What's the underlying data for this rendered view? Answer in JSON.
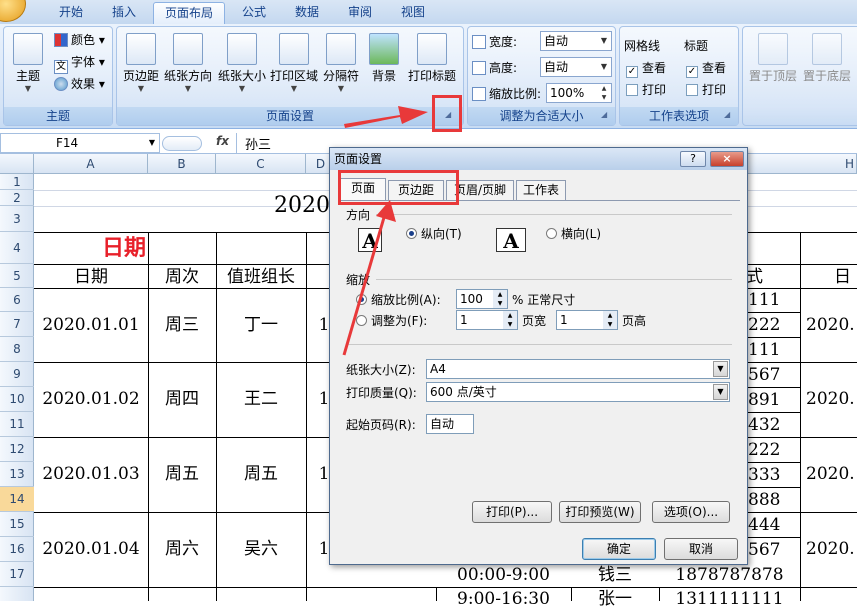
{
  "ribbon_tabs": [
    "开始",
    "插入",
    "页面布局",
    "公式",
    "数据",
    "审阅",
    "视图"
  ],
  "active_tab": "页面布局",
  "groups": {
    "theme": {
      "label": "主题",
      "big_button": "主题",
      "colors": "颜色",
      "fonts": "字体",
      "effects": "效果"
    },
    "page_setup": {
      "label": "页面设置",
      "buttons": [
        "页边距",
        "纸张方向",
        "纸张大小",
        "打印区域",
        "分隔符",
        "背景",
        "打印标题"
      ]
    },
    "scale": {
      "label": "调整为合适大小",
      "width_label": "宽度:",
      "width_value": "自动",
      "height_label": "高度:",
      "height_value": "自动",
      "scale_label": "缩放比例:",
      "scale_value": "100%"
    },
    "sheet_options": {
      "label": "工作表选项",
      "gridlines": "网格线",
      "headings": "标题",
      "view": "查看",
      "print": "打印"
    },
    "arrange": {
      "bring_front": "置于顶层",
      "send_back": "置于底层"
    }
  },
  "formula_bar": {
    "name_box": "F14",
    "fx": "fx",
    "value": "孙三"
  },
  "columns": [
    "A",
    "B",
    "C",
    "D"
  ],
  "right_col": "H",
  "rows": [
    "1",
    "2",
    "3",
    "4",
    "5",
    "6",
    "7",
    "8",
    "9",
    "10",
    "11",
    "12",
    "13",
    "14",
    "15",
    "16",
    "17"
  ],
  "sheet": {
    "title_partial": "2020",
    "red_heading": "日期",
    "header_row": [
      "日期",
      "周次",
      "值班组长"
    ],
    "right_header_partial": "式",
    "right_header_2": "日",
    "blocks": [
      {
        "date": "2020.01.01",
        "week": "周三",
        "leader": "丁一"
      },
      {
        "date": "2020.01.02",
        "week": "周四",
        "leader": "王二"
      },
      {
        "date": "2020.01.03",
        "week": "周五",
        "leader": "周五"
      },
      {
        "date": "2020.01.04",
        "week": "周六",
        "leader": "吴六"
      }
    ],
    "d_partial": "1",
    "phone_partials": [
      "111",
      "222",
      "111",
      "567",
      "891",
      "432",
      "222",
      "333",
      "888",
      "444",
      "567"
    ],
    "right_dates": [
      "2020.",
      "2020.",
      "2020.",
      "2020."
    ],
    "bottom_time_1": "00:00-9:00",
    "bottom_name_1": "钱三",
    "bottom_phone_1": "1878787878",
    "bottom_time_2": "9:00-16:30",
    "bottom_name_2": "张一",
    "bottom_phone_2": "1311111111"
  },
  "dialog": {
    "title": "页面设置",
    "help": "?",
    "close": "×",
    "tabs": [
      "页面",
      "页边距",
      "页眉/页脚",
      "工作表"
    ],
    "orientation_label": "方向",
    "portrait": "纵向(T)",
    "landscape": "横向(L)",
    "scaling_label": "缩放",
    "scale_ratio": "缩放比例(A):",
    "scale_value": "100",
    "scale_suffix": "% 正常尺寸",
    "fit_to": "调整为(F):",
    "fit_wide_value": "1",
    "fit_wide": "页宽",
    "fit_tall_value": "1",
    "fit_tall": "页高",
    "paper_size_label": "纸张大小(Z):",
    "paper_size": "A4",
    "print_quality_label": "打印质量(Q):",
    "print_quality": "600 点/英寸",
    "first_page_label": "起始页码(R):",
    "first_page": "自动",
    "print_btn": "打印(P)...",
    "preview_btn": "打印预览(W)",
    "options_btn": "选项(O)...",
    "ok_btn": "确定",
    "cancel_btn": "取消"
  },
  "annotation_color": "#e8393a"
}
